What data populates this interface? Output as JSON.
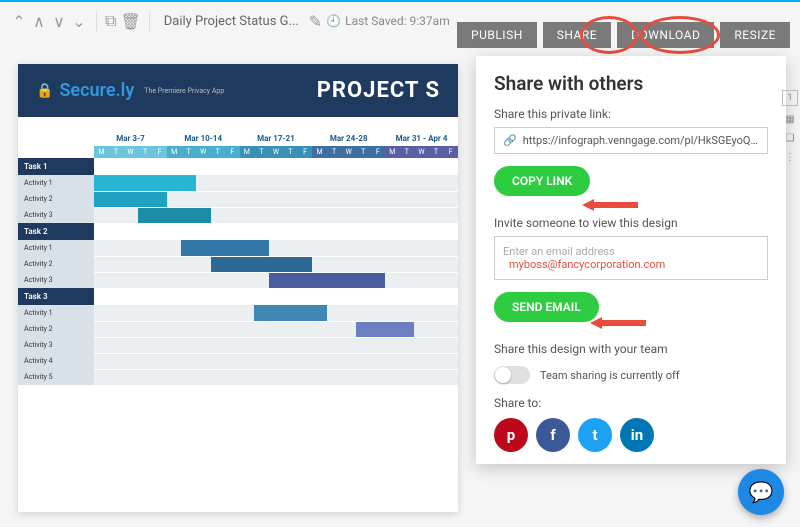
{
  "topbar": {
    "doc_title": "Daily Project Status G...",
    "last_saved": "Last Saved: 9:37am"
  },
  "actions": {
    "publish": "PUBLISH",
    "share": "SHARE",
    "download": "DOWNLOAD",
    "resize": "RESIZE"
  },
  "canvas": {
    "brand_name": "Secure.ly",
    "brand_tag": "The Premiere Privacy App",
    "title": "PROJECT S",
    "date_ranges": [
      "Mar 3-7",
      "Mar 10-14",
      "Mar 17-21",
      "Mar 24-28",
      "Mar 31 - Apr 4"
    ],
    "days": [
      "M",
      "T",
      "W",
      "T",
      "F"
    ],
    "rows": [
      {
        "type": "task",
        "label": "Task 1"
      },
      {
        "type": "act",
        "label": "Activity 1",
        "fill": {
          "start": 0,
          "len": 7,
          "color": "#27b5d6"
        }
      },
      {
        "type": "act",
        "label": "Activity 2",
        "fill": {
          "start": 0,
          "len": 5,
          "color": "#1fa2bf"
        }
      },
      {
        "type": "act",
        "label": "Activity 3",
        "fill": {
          "start": 3,
          "len": 5,
          "color": "#1b8da6"
        }
      },
      {
        "type": "task",
        "label": "Task 2"
      },
      {
        "type": "act",
        "label": "Activity 1",
        "fill": {
          "start": 6,
          "len": 6,
          "color": "#3178a8"
        }
      },
      {
        "type": "act",
        "label": "Activity 2",
        "fill": {
          "start": 8,
          "len": 7,
          "color": "#2c6a95"
        }
      },
      {
        "type": "act",
        "label": "Activity 3",
        "fill": {
          "start": 12,
          "len": 8,
          "color": "#4b5c9e"
        }
      },
      {
        "type": "task",
        "label": "Task 3"
      },
      {
        "type": "act",
        "label": "Activity 1",
        "fill": {
          "start": 11,
          "len": 5,
          "color": "#3f87b5"
        }
      },
      {
        "type": "act",
        "label": "Activity 2",
        "fill": {
          "start": 18,
          "len": 4,
          "color": "#6b7fc2"
        }
      },
      {
        "type": "act",
        "label": "Activity 3"
      },
      {
        "type": "act",
        "label": "Activity 4"
      },
      {
        "type": "act",
        "label": "Activity 5"
      }
    ]
  },
  "share": {
    "title": "Share with others",
    "link_label": "Share this private link:",
    "link_value": "https://infograph.venngage.com/pl/HkSGEyoQsU",
    "copy_btn": "COPY LINK",
    "invite_label": "Invite someone to view this design",
    "email_placeholder": "Enter an email address",
    "email_typed": "myboss@fancycorporation.com",
    "send_btn": "SEND EMAIL",
    "team_label": "Share this design with your team",
    "team_status": "Team sharing is currently off",
    "share_to": "Share to:",
    "social": [
      {
        "name": "pinterest",
        "color": "#bd081c",
        "glyph": "p"
      },
      {
        "name": "facebook",
        "color": "#3b5998",
        "glyph": "f"
      },
      {
        "name": "twitter",
        "color": "#1da1f2",
        "glyph": "t"
      },
      {
        "name": "linkedin",
        "color": "#0077b5",
        "glyph": "in"
      }
    ]
  },
  "right_rail": {
    "page": "1"
  },
  "day_header_colors": [
    "#6bc5dd",
    "#49aecb",
    "#3a8fb5",
    "#3f6fa0",
    "#5a5fa3"
  ]
}
